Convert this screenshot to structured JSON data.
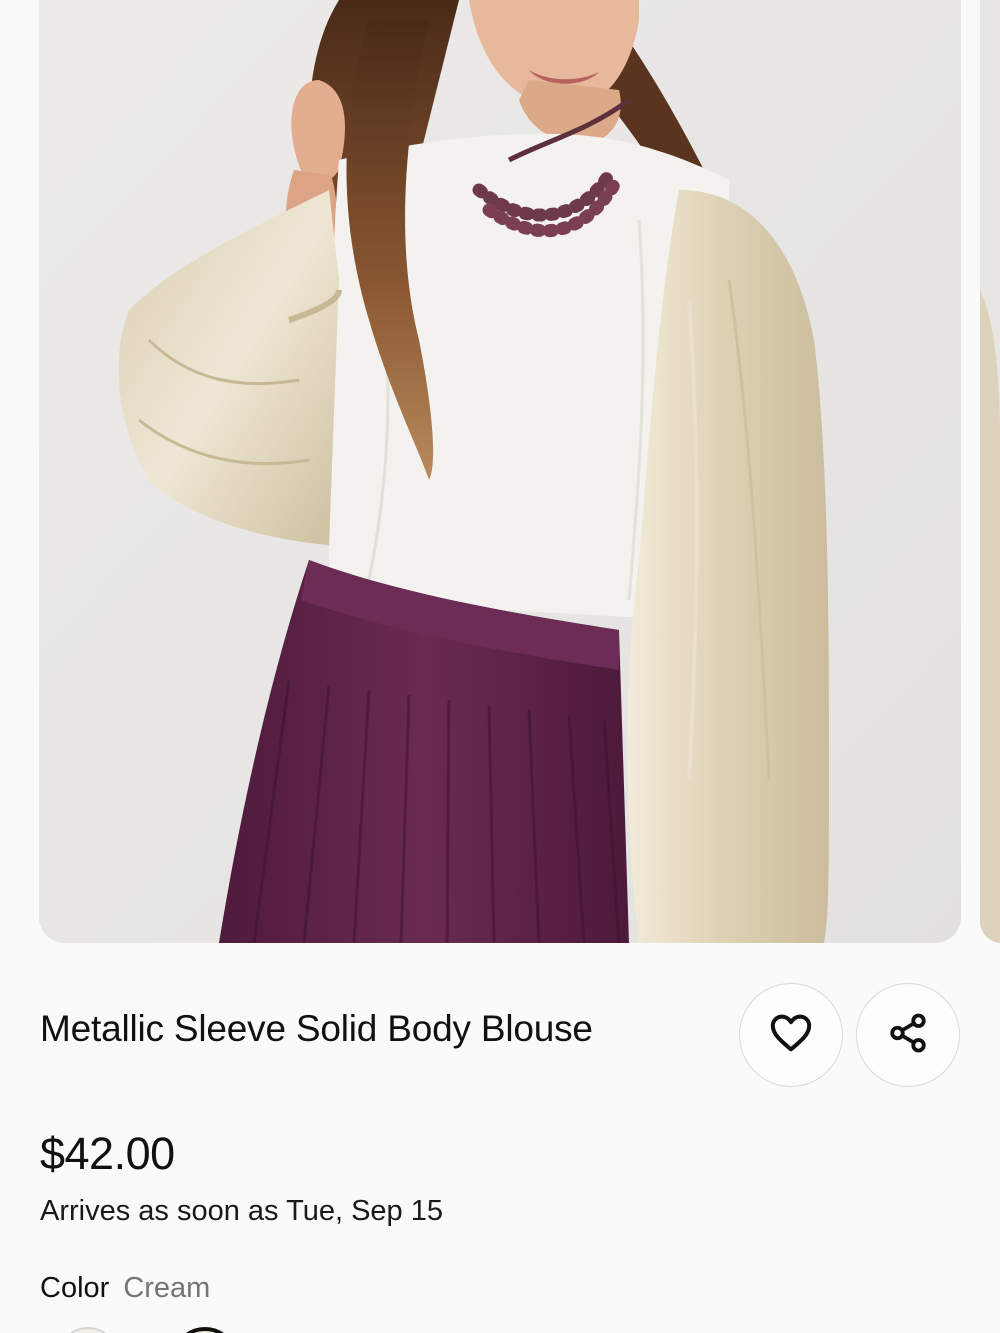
{
  "product": {
    "title": "Metallic Sleeve Solid Body Blouse",
    "price": "$42.00",
    "arrival": "Arrives as soon as Tue, Sep 15",
    "color_label": "Color",
    "color_value": "Cream"
  },
  "icons": {
    "favorite": "heart-icon",
    "share": "share-icon"
  },
  "colors": {
    "background": "#fafafa",
    "skirt": "#5e2447",
    "blouse_body": "#f3f1ec",
    "sleeve": "#e3d9c2",
    "hair": "#6b4228",
    "necklace": "#6e3a4a"
  }
}
